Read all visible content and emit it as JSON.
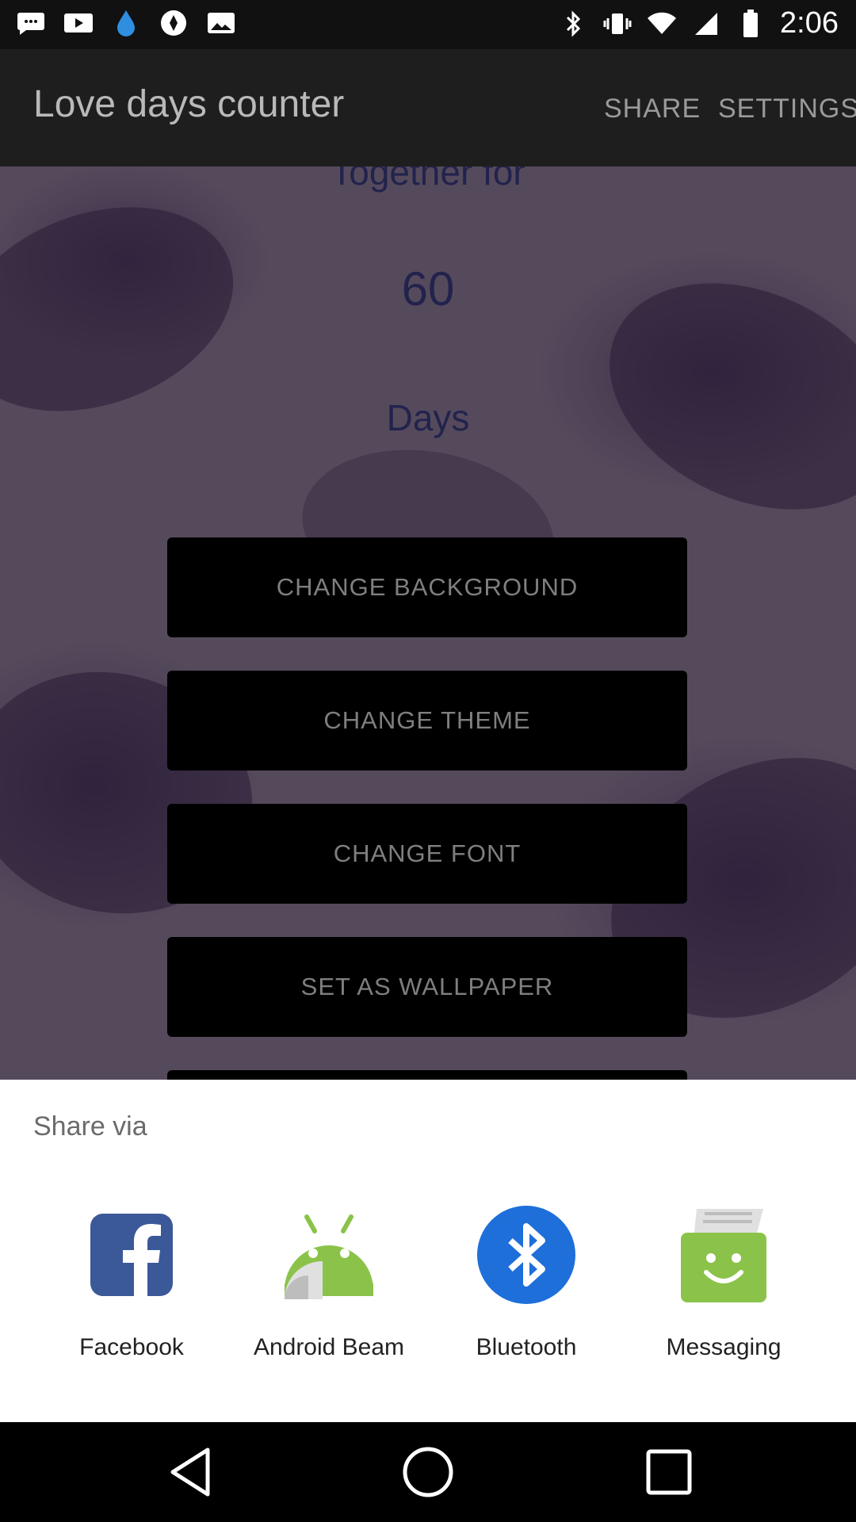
{
  "status_bar": {
    "time": "2:06",
    "left_icons": [
      "messages-icon",
      "video-icon",
      "water-drop-icon",
      "compass-icon",
      "gallery-icon"
    ],
    "right_icons": [
      "bluetooth-icon",
      "vibrate-icon",
      "wifi-icon",
      "signal-icon",
      "battery-icon"
    ]
  },
  "app_bar": {
    "title": "Love days counter",
    "share_label": "SHARE",
    "settings_label": "SETTINGS"
  },
  "counter": {
    "together_text": "Together for",
    "days_count": "60",
    "days_label": "Days"
  },
  "menu": {
    "change_background": "CHANGE BACKGROUND",
    "change_theme": "CHANGE THEME",
    "change_font": "CHANGE FONT",
    "set_as_wallpaper": "SET AS WALLPAPER"
  },
  "share_sheet": {
    "title": "Share via",
    "items": [
      {
        "label": "Facebook",
        "icon": "facebook-icon",
        "color": "#3b5998"
      },
      {
        "label": "Android Beam",
        "icon": "android-beam-icon",
        "color": "#8bc34a"
      },
      {
        "label": "Bluetooth",
        "icon": "bluetooth-icon",
        "color": "#1e6fd9"
      },
      {
        "label": "Messaging",
        "icon": "messaging-icon",
        "color": "#8bc34a"
      }
    ]
  },
  "nav_bar": {
    "buttons": [
      "back-icon",
      "home-icon",
      "recents-icon"
    ]
  }
}
